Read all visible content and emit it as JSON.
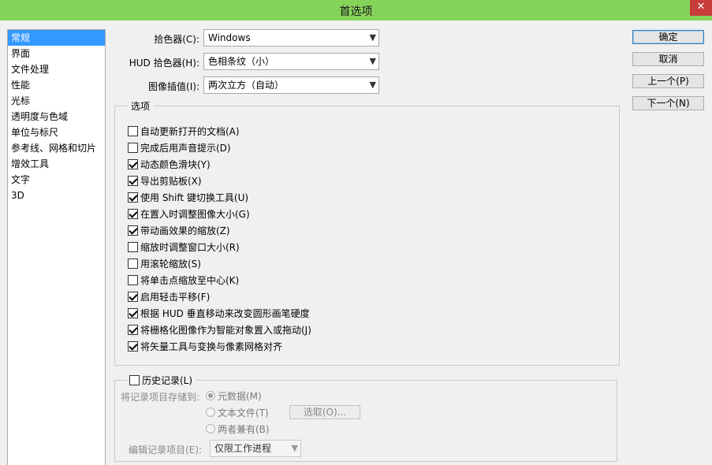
{
  "window": {
    "title": "首选项",
    "close_label": "✕",
    "title_bar_color": "#86d35a"
  },
  "sidebar": {
    "items": [
      {
        "label": "常规",
        "selected": true
      },
      {
        "label": "界面"
      },
      {
        "label": "文件处理"
      },
      {
        "label": "性能"
      },
      {
        "label": "光标"
      },
      {
        "label": "透明度与色域"
      },
      {
        "label": "单位与标尺"
      },
      {
        "label": "参考线、网格和切片"
      },
      {
        "label": "增效工具"
      },
      {
        "label": "文字"
      },
      {
        "label": "3D"
      }
    ]
  },
  "general": {
    "color_picker": {
      "label": "拾色器(C):",
      "value": "Windows"
    },
    "hud_color_picker": {
      "label": "HUD 拾色器(H):",
      "value": "色相条纹（小）"
    },
    "interpolation": {
      "label": "图像插值(I):",
      "value": "两次立方（自动）"
    }
  },
  "options": {
    "legend": "选项",
    "items": [
      {
        "label": "自动更新打开的文档(A)",
        "checked": false
      },
      {
        "label": "完成后用声音提示(D)",
        "checked": false
      },
      {
        "label": "动态颜色滑块(Y)",
        "checked": true
      },
      {
        "label": "导出剪贴板(X)",
        "checked": true
      },
      {
        "label": "使用 Shift 键切换工具(U)",
        "checked": true
      },
      {
        "label": "在置入时调整图像大小(G)",
        "checked": true
      },
      {
        "label": "带动画效果的缩放(Z)",
        "checked": true
      },
      {
        "label": "缩放时调整窗口大小(R)",
        "checked": false
      },
      {
        "label": "用滚轮缩放(S)",
        "checked": false
      },
      {
        "label": "将单击点缩放至中心(K)",
        "checked": false
      },
      {
        "label": "启用轻击平移(F)",
        "checked": true
      },
      {
        "label": "根据 HUD 垂直移动来改变圆形画笔硬度",
        "checked": true
      },
      {
        "label": "将栅格化图像作为智能对象置入或拖动(J)",
        "checked": true
      },
      {
        "label": "将矢量工具与变换与像素网格对齐",
        "checked": true
      }
    ]
  },
  "history": {
    "legend": "历史记录(L)",
    "checked": false,
    "save_to_label": "将记录项目存储到:",
    "radios": [
      {
        "label": "元数据(M)",
        "selected": true
      },
      {
        "label": "文本文件(T)",
        "selected": false
      },
      {
        "label": "两者兼有(B)",
        "selected": false
      }
    ],
    "choose_button": "选取(O)...",
    "edit_log_label": "编辑记录项目(E):",
    "edit_log_value": "仅限工作进程"
  },
  "buttons": {
    "ok": "确定",
    "cancel": "取消",
    "prev": "上一个(P)",
    "next": "下一个(N)"
  }
}
